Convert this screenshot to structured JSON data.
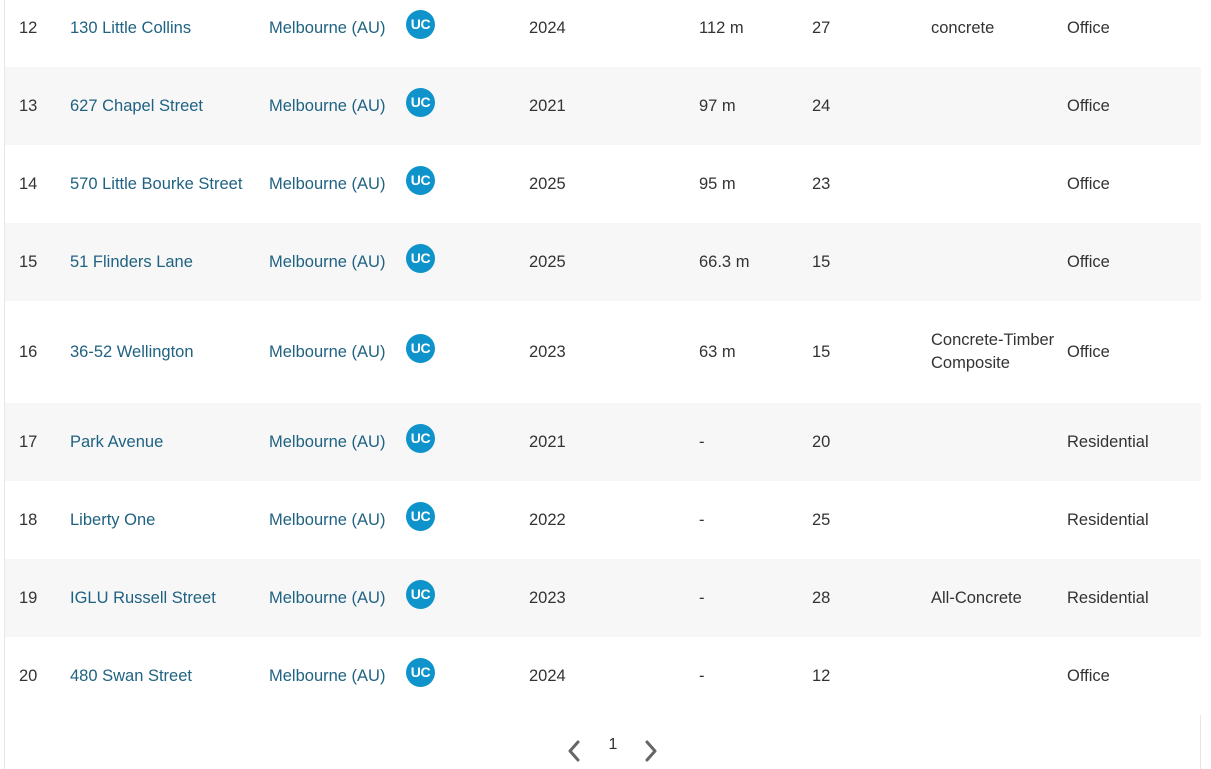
{
  "rows": [
    {
      "rank": "12",
      "name": "130 Little Collins",
      "city": "Melbourne (AU)",
      "status": "UC",
      "year": "2024",
      "height": "112 m",
      "floors": "27",
      "material": "concrete",
      "function": "Office"
    },
    {
      "rank": "13",
      "name": "627 Chapel Street",
      "city": "Melbourne (AU)",
      "status": "UC",
      "year": "2021",
      "height": "97 m",
      "floors": "24",
      "material": "",
      "function": "Office"
    },
    {
      "rank": "14",
      "name": "570 Little Bourke Street",
      "city": "Melbourne (AU)",
      "status": "UC",
      "year": "2025",
      "height": "95 m",
      "floors": "23",
      "material": "",
      "function": "Office"
    },
    {
      "rank": "15",
      "name": "51 Flinders Lane",
      "city": "Melbourne (AU)",
      "status": "UC",
      "year": "2025",
      "height": "66.3 m",
      "floors": "15",
      "material": "",
      "function": "Office"
    },
    {
      "rank": "16",
      "name": "36-52 Wellington",
      "city": "Melbourne (AU)",
      "status": "UC",
      "year": "2023",
      "height": "63 m",
      "floors": "15",
      "material": "Concrete-Timber Composite",
      "function": "Office"
    },
    {
      "rank": "17",
      "name": "Park Avenue",
      "city": "Melbourne (AU)",
      "status": "UC",
      "year": "2021",
      "height": "-",
      "floors": "20",
      "material": "",
      "function": "Residential"
    },
    {
      "rank": "18",
      "name": "Liberty One",
      "city": "Melbourne (AU)",
      "status": "UC",
      "year": "2022",
      "height": "-",
      "floors": "25",
      "material": "",
      "function": "Residential"
    },
    {
      "rank": "19",
      "name": "IGLU Russell Street",
      "city": "Melbourne (AU)",
      "status": "UC",
      "year": "2023",
      "height": "-",
      "floors": "28",
      "material": "All-Concrete",
      "function": "Residential"
    },
    {
      "rank": "20",
      "name": "480 Swan Street",
      "city": "Melbourne (AU)",
      "status": "UC",
      "year": "2024",
      "height": "-",
      "floors": "12",
      "material": "",
      "function": "Office"
    }
  ],
  "pagination": {
    "current_page": "1",
    "prev_icon": "chevron-left-icon",
    "next_icon": "chevron-right-icon"
  },
  "colors": {
    "link": "#1f6282",
    "badge": "#0f93cb",
    "row_alt": "#f7f7f7",
    "text": "#333333"
  }
}
